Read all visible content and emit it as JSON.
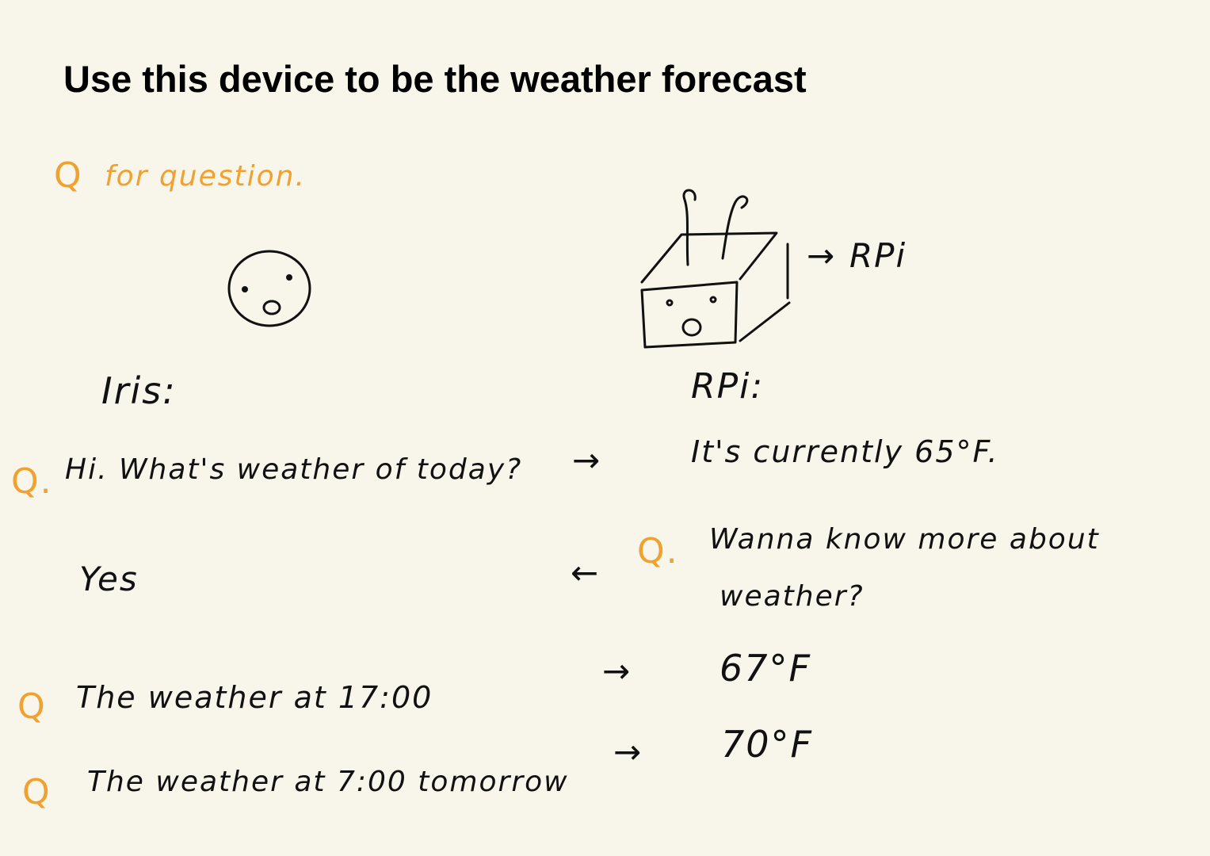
{
  "title": "Use this device to be the weather forecast",
  "legend": {
    "marker": "Q",
    "text": "for question."
  },
  "speakers": {
    "person": "Iris:",
    "device": "RPi:",
    "device_label": "RPi"
  },
  "arrows": {
    "right": "→",
    "left": "←"
  },
  "dialogue": [
    {
      "q_marker": "Q.",
      "iris": "Hi. What's weather of today?",
      "rpi": "It's currently 65°F."
    },
    {
      "q_marker": "Q.",
      "rpi": "Wanna know more about",
      "rpi_line2": "weather?",
      "iris": "Yes"
    },
    {
      "q_marker": "Q",
      "iris": "The weather at 17:00",
      "rpi": "67°F"
    },
    {
      "q_marker": "Q",
      "iris": "The weather at 7:00 tomorrow",
      "rpi": "70°F"
    }
  ],
  "colors": {
    "accent": "#f0a130",
    "ink": "#111111",
    "background": "#f8f5ea"
  }
}
